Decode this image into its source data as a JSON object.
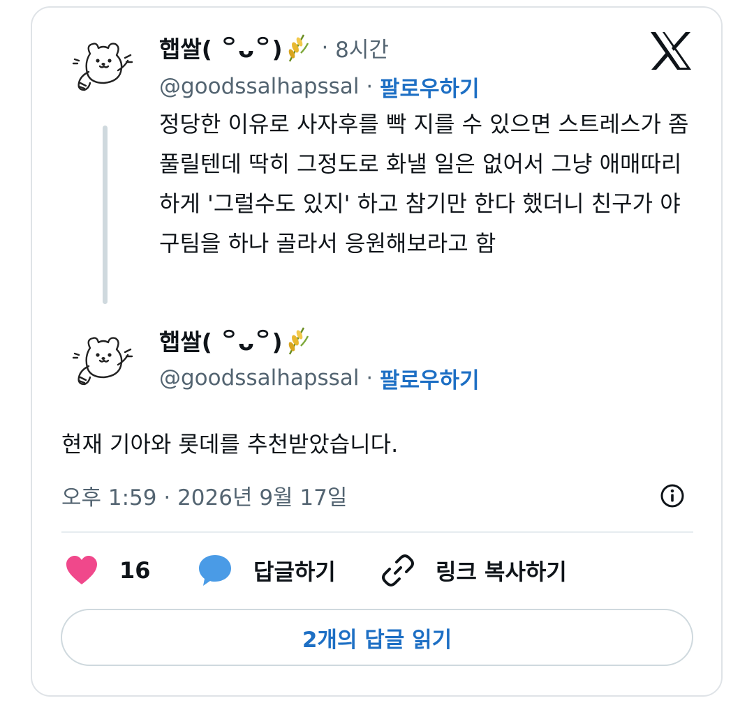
{
  "tweet1": {
    "display_name": "햅쌀( ꒪ᴗ꒪)",
    "time_ago": "8시간",
    "handle": "@goodssalhapssal",
    "follow_label": "팔로우하기",
    "text": "정당한 이유로 사자후를 빡 지를 수 있으면 스트레스가 좀 풀릴텐데 딱히 그정도로 화낼 일은 없어서 그냥 애매따리하게 '그럴수도 있지' 하고 참기만 한다 했더니 친구가 야구팀을 하나 골라서 응원해보라고 함"
  },
  "tweet2": {
    "display_name": "햅쌀( ꒪ᴗ꒪)",
    "handle": "@goodssalhapssal",
    "follow_label": "팔로우하기",
    "text": "현재 기아와 롯데를 추천받았습니다.",
    "timestamp": "오후 1:59 · 2026년 9월 17일"
  },
  "actions": {
    "like_count": "16",
    "reply_label": "답글하기",
    "copy_link_label": "링크 복사하기"
  },
  "read_replies_label": "2개의 답글 읽기",
  "separator": "·",
  "colors": {
    "accent": "#1d6fc4",
    "like": "#f0488b",
    "reply_bubble": "#4a9be6",
    "muted_text": "#536471",
    "border": "#dfe3e7"
  },
  "icons": [
    "x-logo-icon",
    "heart-icon",
    "reply-bubble-icon",
    "link-icon",
    "info-icon",
    "rice-emoji-icon"
  ]
}
